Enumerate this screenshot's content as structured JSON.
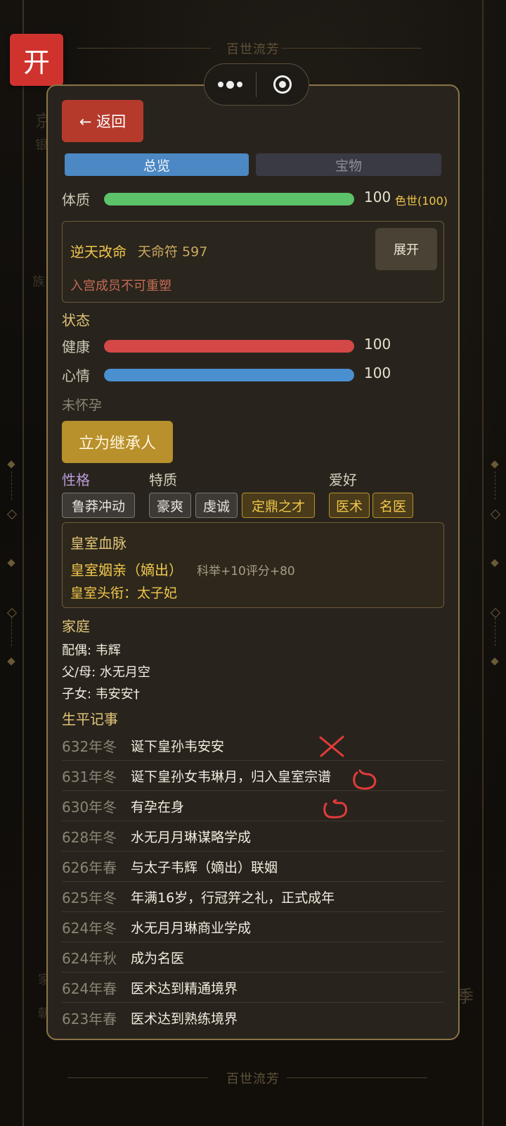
{
  "background": {
    "title_top": "百世流芳",
    "title_bottom": "百世流芳",
    "obscured": [
      "京",
      "银",
      "族",
      "朝",
      "家"
    ],
    "right_season": "季"
  },
  "open_button": {
    "label": "开"
  },
  "back_button": {
    "label": "← 返回"
  },
  "tabs": [
    {
      "label": "总览",
      "active": true
    },
    {
      "label": "宝物",
      "active": false
    }
  ],
  "constitution": {
    "label": "体质",
    "value": "100",
    "percent": 100,
    "tier": "色世(100)",
    "color": "#5cc36a"
  },
  "fate": {
    "title": "逆天改命",
    "talisman": "天命符 597",
    "note": "入宫成员不可重塑",
    "expand_label": "展开"
  },
  "status": {
    "heading": "状态",
    "health": {
      "label": "健康",
      "value": "100",
      "percent": 100,
      "color": "#d44848"
    },
    "mood": {
      "label": "心情",
      "value": "100",
      "percent": 100,
      "color": "#4a90d0"
    },
    "pregnancy": "未怀孕"
  },
  "heir_button": {
    "label": "立为继承人"
  },
  "traits": {
    "personality_label": "性格",
    "personality": [
      "鲁莽冲动"
    ],
    "qualities_label": "特质",
    "qualities": [
      "豪爽",
      "虔诚",
      "定鼎之才"
    ],
    "hobbies_label": "爱好",
    "hobbies": [
      "医术",
      "名医"
    ]
  },
  "royal": {
    "heading": "皇室血脉",
    "relation": "皇室姻亲（嫡出）",
    "bonus": "科举+10评分+80",
    "title": "皇室头衔：太子妃"
  },
  "family": {
    "heading": "家庭",
    "spouse": "配偶: 韦辉",
    "parents": "父/母: 水无月空",
    "children": "子女: 韦安安†"
  },
  "events_heading": "生平记事",
  "events": [
    {
      "date": "632年冬",
      "desc": "诞下皇孙韦安安"
    },
    {
      "date": "631年冬",
      "desc": "诞下皇孙女韦琳月，归入皇室宗谱"
    },
    {
      "date": "630年冬",
      "desc": "有孕在身"
    },
    {
      "date": "628年冬",
      "desc": "水无月月琳谋略学成"
    },
    {
      "date": "626年春",
      "desc": "与太子韦辉（嫡出）联姻"
    },
    {
      "date": "625年冬",
      "desc": "年满16岁，行冠笄之礼，正式成年"
    },
    {
      "date": "624年冬",
      "desc": "水无月月琳商业学成"
    },
    {
      "date": "624年秋",
      "desc": "成为名医"
    },
    {
      "date": "624年春",
      "desc": "医术达到精通境界"
    },
    {
      "date": "623年春",
      "desc": "医术达到熟练境界"
    }
  ]
}
